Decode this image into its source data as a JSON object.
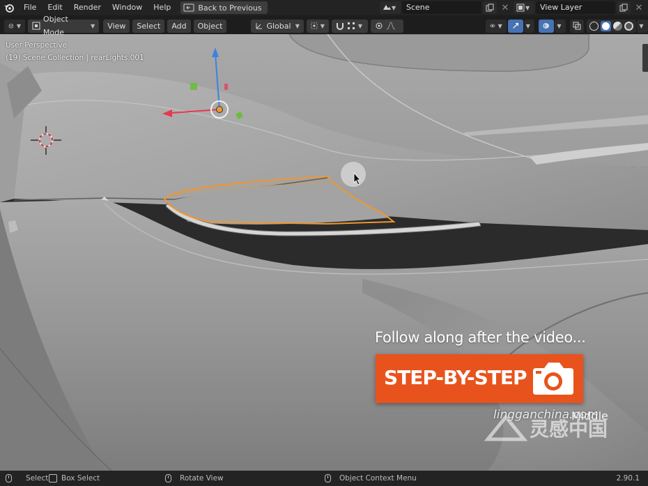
{
  "menu": {
    "items": [
      "File",
      "Edit",
      "Render",
      "Window",
      "Help"
    ],
    "back_label": "Back to Previous"
  },
  "scene": {
    "name": "Scene",
    "view_layer": "View Layer"
  },
  "header": {
    "mode": "Object Mode",
    "view": "View",
    "select": "Select",
    "add": "Add",
    "object": "Object",
    "transform_orientation": "Global"
  },
  "viewport": {
    "perspective": "User Perspective",
    "collection": "(19) Scene Collection | rearLights.001"
  },
  "promo": {
    "title": "Follow along after the video...",
    "label": "STEP-BY-STEP"
  },
  "watermark": {
    "text": "lingganchina.com",
    "brand": "Middle"
  },
  "status": {
    "select": "Select",
    "box_select": "Box Select",
    "rotate_view": "Rotate View",
    "context_menu": "Object Context Menu",
    "version": "2.90.1"
  },
  "colors": {
    "accent_orange": "#e8531d",
    "selection_outline": "#f0962e",
    "gizmo_x": "#e8384f",
    "gizmo_y": "#6cbd3c",
    "gizmo_z": "#3b83e0"
  }
}
